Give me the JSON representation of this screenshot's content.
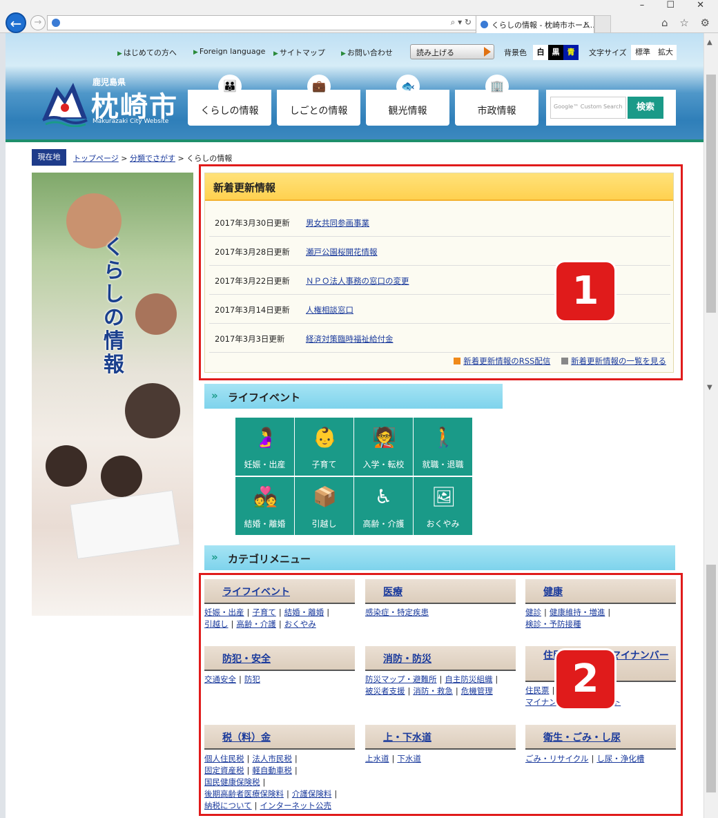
{
  "browser": {
    "tab_title": "くらしの情報 - 枕崎市ホーム...",
    "tab_close": "×",
    "addr_controls": "⌕ ▾ ↻",
    "window_controls": "– ☐ ✕",
    "toolbar_icons": "⌂ ☆ ⚙"
  },
  "utility": {
    "links": [
      "はじめての方へ",
      "Foreign language",
      "サイトマップ",
      "お問い合わせ"
    ],
    "read_aloud": "読み上げる",
    "bg_label": "背景色",
    "bg_options": [
      "白",
      "黒",
      "青"
    ],
    "font_label": "文字サイズ",
    "font_options": [
      "標準",
      "拡大"
    ]
  },
  "logo": {
    "prefecture": "鹿児島県",
    "city": "枕崎市",
    "website": "Makurazaki City Website"
  },
  "nav": [
    "くらしの情報",
    "しごとの情報",
    "観光情報",
    "市政情報"
  ],
  "search": {
    "placeholder": "Google™ Custom Search",
    "button": "検索"
  },
  "breadcrumb": {
    "tag": "現在地",
    "items": [
      "トップページ",
      "分類でさがす",
      "くらしの情報"
    ],
    "sep": ">"
  },
  "side": {
    "title": "くらしの情報"
  },
  "news": {
    "heading": "新着更新情報",
    "rows": [
      {
        "date": "2017年3月30日更新",
        "link": "男女共同参画事業"
      },
      {
        "date": "2017年3月28日更新",
        "link": "瀬戸公園桜開花情報"
      },
      {
        "date": "2017年3月22日更新",
        "link": "ＮＰＯ法人事務の窓口の変更"
      },
      {
        "date": "2017年3月14日更新",
        "link": "人権相談窓口"
      },
      {
        "date": "2017年3月3日更新",
        "link": "経済対策臨時福祉給付金"
      }
    ],
    "rss": "新着更新情報のRSS配信",
    "all": "新着更新情報の一覧を見る"
  },
  "badges": [
    "1",
    "2"
  ],
  "life": {
    "heading": "ライフイベント",
    "tiles": [
      "妊娠・出産",
      "子育て",
      "入学・転校",
      "就職・退職",
      "結婚・離婚",
      "引越し",
      "高齢・介護",
      "おくやみ"
    ]
  },
  "category": {
    "heading": "カテゴリメニュー",
    "groups": [
      {
        "title": "ライフイベント",
        "links": [
          "妊娠・出産",
          "子育て",
          "結婚・離婚",
          "引越し",
          "高齢・介護",
          "おくやみ"
        ]
      },
      {
        "title": "医療",
        "links": [
          "感染症・特定疾患"
        ]
      },
      {
        "title": "健康",
        "links": [
          "健診",
          "健康維持・増進",
          "検診・予防接種"
        ]
      },
      {
        "title": "防犯・安全",
        "links": [
          "交通安全",
          "防犯"
        ]
      },
      {
        "title": "消防・防災",
        "links": [
          "防災マップ・避難所",
          "自主防災組織",
          "被災者支援",
          "消防・救急",
          "危機管理"
        ]
      },
      {
        "title": "住民票・戸籍・マイナンバー",
        "links": [
          "住民票",
          "戸籍",
          "マイナンバー",
          "パスポート"
        ]
      },
      {
        "title": "税（料）金",
        "links": [
          "個人住民税",
          "法人市民税",
          "固定資産税",
          "軽自動車税",
          "国民健康保険税",
          "後期高齢者医療保険料",
          "介護保険料",
          "納税について",
          "インターネット公売"
        ]
      },
      {
        "title": "上・下水道",
        "links": [
          "上水道",
          "下水道"
        ]
      },
      {
        "title": "衛生・ごみ・し尿",
        "links": [
          "ごみ・リサイクル",
          "し尿・浄化槽"
        ]
      }
    ]
  },
  "colors": {
    "accent": "#1a9a88",
    "annotation": "#e01b1b",
    "link": "#1a3a9c"
  }
}
